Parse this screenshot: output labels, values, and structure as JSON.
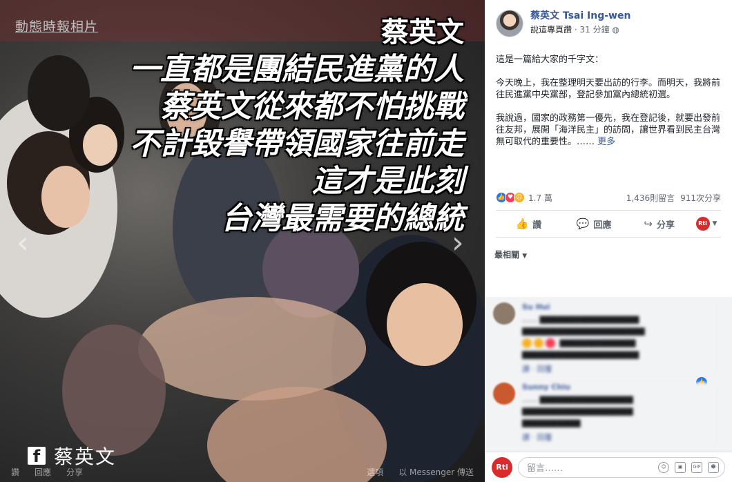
{
  "photo": {
    "album_tag": "動態時報相片",
    "slogan_name": "蔡英文",
    "slogan_lines": [
      "一直都是團結民進黨的人",
      "蔡英文從來都不怕挑戰",
      "不計毀譽帶領國家往前走",
      "這才是此刻",
      "台灣最需要的總統"
    ],
    "watermark_name": "蔡英文",
    "bottom_bar": {
      "like": "讚",
      "comment": "回應",
      "share": "分享",
      "select": "選項",
      "send": "以 Messenger 傳送"
    }
  },
  "post": {
    "page_name": "蔡英文 Tsai Ing-wen",
    "say_page": "說這專頁讚",
    "time": "31 分鐘",
    "paragraphs": [
      "這是一篇給大家的千字文：",
      "今天晚上，我在整理明天要出訪的行李。而明天，我將前往民進黨中央黨部，登記參加黨內總統初選。",
      "我說過，國家的政務第一優先，我在登記後，就要出發前往友邦，展開「海洋民主」的訪問，讓世界看到民主台灣無可取代的重要性。……"
    ],
    "more": "更多",
    "reaction_count": "1.7 萬",
    "comment_count": "1,436則留言",
    "share_count": "911次分享",
    "actions": {
      "like": "讚",
      "comment": "回應",
      "share": "分享"
    },
    "sort_label": "最相關"
  },
  "comments": [
    {
      "name": "Su Hui",
      "text": "……",
      "links": "讚 · 回覆"
    },
    {
      "name": "Sunny Chiu",
      "text": "……",
      "links": "讚 · 回覆"
    }
  ],
  "compose": {
    "placeholder": "留言……",
    "gif": "GIF",
    "logo_text": "Rti"
  }
}
